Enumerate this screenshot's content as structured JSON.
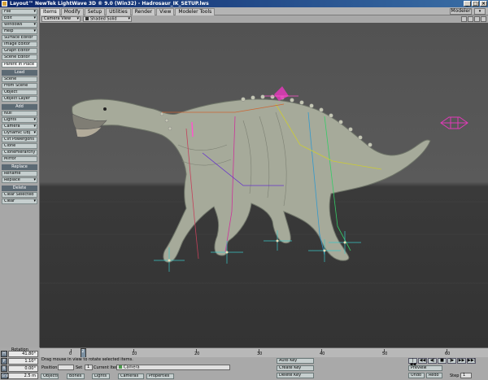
{
  "window": {
    "title": "Layout™ NewTek LightWave 3D ® 9.0 (Win32) - Hadrosaur_IK_SETUP.lws",
    "minimize": "_",
    "maximize": "□",
    "close": "×"
  },
  "tabs": [
    "Items",
    "Modify",
    "Setup",
    "Utilities",
    "Render",
    "View",
    "Modeler Tools"
  ],
  "active_tab": "Items",
  "modeler_button": "Modeler",
  "menus": {
    "file": "File",
    "edit": "Edit",
    "windows": "Windows",
    "help": "Help"
  },
  "editors": [
    "Surface Editor",
    "Image Editor",
    "Graph Editor",
    "Scene Editor"
  ],
  "parent_in_place": "Parent in Place",
  "load": {
    "header": "Load",
    "items": [
      "Scene",
      "From Scene",
      "Object",
      "Object Layer"
    ]
  },
  "add": {
    "header": "Add",
    "items": [
      "Null",
      "Lights",
      "Camera",
      "Dynamic Obj",
      "Cvt Powergons",
      "Clone",
      "CloneHierarchy",
      "Mirror"
    ]
  },
  "replace": {
    "header": "Replace",
    "items": [
      "Rename",
      "Replace"
    ]
  },
  "delete": {
    "header": "Delete",
    "items": [
      "Clear Selected",
      "Clear"
    ]
  },
  "viewport": {
    "view_mode": "Camera View",
    "shading": "Shaded Solid"
  },
  "timeline": {
    "ticks": [
      "0",
      "10",
      "20",
      "30",
      "40",
      "50",
      "60"
    ],
    "current_frame": "2",
    "end_label": "60"
  },
  "rotation": {
    "label": "Rotation",
    "rows": [
      {
        "axis": "H",
        "value": "41.80°"
      },
      {
        "axis": "P",
        "value": "1.10°"
      },
      {
        "axis": "B",
        "value": "0.00°"
      }
    ]
  },
  "grid": {
    "label": "Grid",
    "value": "2.5 m"
  },
  "status_message": "Drag mouse in view to rotate selected items.",
  "position": {
    "label": "Position",
    "value": ""
  },
  "set": {
    "label": "Set",
    "value": "1"
  },
  "current_item": {
    "label": "Current Item",
    "value": "Camera"
  },
  "filters": [
    "Objects",
    "Bones",
    "Lights",
    "Cameras",
    "Properties"
  ],
  "keys": {
    "auto_key": "Auto Key",
    "create_key": "Create Key",
    "delete_key": "Delete Key"
  },
  "playback": {
    "preview": "Preview",
    "undo": "Undo",
    "redo": "Redo",
    "step_label": "Step",
    "step_value": "1",
    "buttons": [
      "|◀◀",
      "◀◀",
      "◀|",
      "■",
      "|▶",
      "▶▶",
      "▶▶|"
    ]
  },
  "colors": {
    "accent": "#5c6a74",
    "button": "#c6cfcf",
    "panel": "#a9a9a9",
    "viewport_bg": "#565656",
    "floor": "#363636"
  }
}
